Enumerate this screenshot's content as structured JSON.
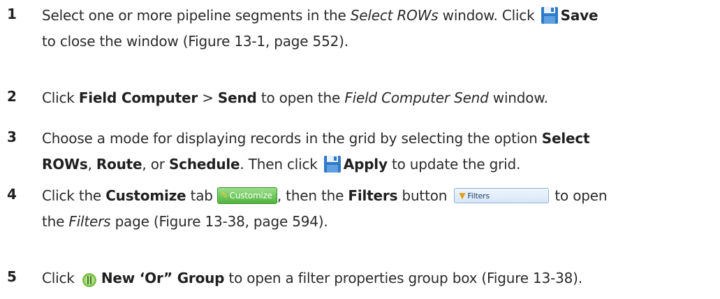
{
  "steps": [
    {
      "number": "1",
      "line1": {
        "t1": "Select one or more pipeline segments in the ",
        "t2": "Select ROWs",
        "t3": " window. Click ",
        "t4": "Save"
      },
      "line2": "to close the window (Figure 13-1, page 552)."
    },
    {
      "number": "2",
      "line1": {
        "t1": "Click ",
        "t2": "Field Computer",
        "t3": " > ",
        "t4": "Send",
        "t5": " to open the ",
        "t6": "Field Computer Send",
        "t7": " window."
      }
    },
    {
      "number": "3",
      "line1": {
        "t1": "Choose a mode for displaying records in the grid by selecting the option ",
        "t2": "Select"
      },
      "line2": {
        "t1": "ROWs",
        "t2": ", ",
        "t3": "Route",
        "t4": ", or ",
        "t5": "Schedule",
        "t6": ". Then click ",
        "t7": "Apply",
        "t8": " to update the grid."
      }
    },
    {
      "number": "4",
      "line1": {
        "t1": "Click the ",
        "t2": "Customize",
        "t3": " tab ",
        "t4": ", then the ",
        "t5": "Filters",
        "t6": " button ",
        "t7": "to open"
      },
      "customize_tab_label": "Customize",
      "filters_button_label": "Filters",
      "line2": {
        "t1": "the ",
        "t2": "Filters",
        "t3": " page (Figure 13-38, page 594)."
      }
    },
    {
      "number": "5",
      "line1": {
        "t1": "Click ",
        "t2": "New ‘Or” Group",
        "t3": " to open a filter properties group box (Figure 13-38)."
      }
    }
  ],
  "icons": {
    "save": "save-disk-icon",
    "or_group": "or-group-icon",
    "customize": "wrench-icon",
    "filters": "funnel-icon"
  },
  "colors": {
    "text": "#2a2a2a",
    "save_blue": "#2f79c9",
    "customize_green": "#4fb43c",
    "filters_blue": "#d7e7f8"
  }
}
